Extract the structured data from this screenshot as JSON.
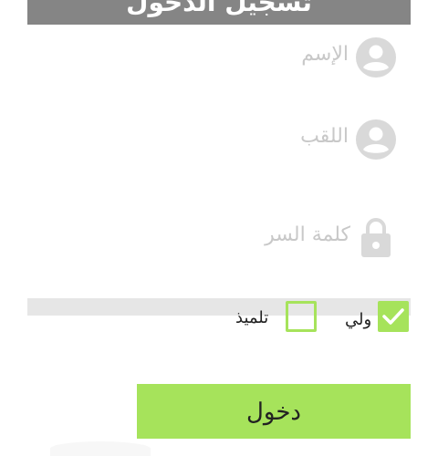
{
  "header": {
    "title": "تسجيل الدخول"
  },
  "form": {
    "first_name": {
      "placeholder": "الإسم",
      "icon": "account-circle-icon"
    },
    "last_name": {
      "placeholder": "اللقب",
      "icon": "account-circle-icon"
    },
    "password": {
      "placeholder": "كلمة  السر",
      "icon": "lock-icon"
    }
  },
  "roles": {
    "parent": {
      "label": "ولي",
      "checked": true
    },
    "student": {
      "label": "تلميذ",
      "checked": false
    }
  },
  "login_button": {
    "label": "دخول"
  },
  "colors": {
    "accent": "#a6e35b",
    "header": "#858585",
    "placeholder": "#c8c8c8",
    "icon": "#d9d9d9"
  }
}
